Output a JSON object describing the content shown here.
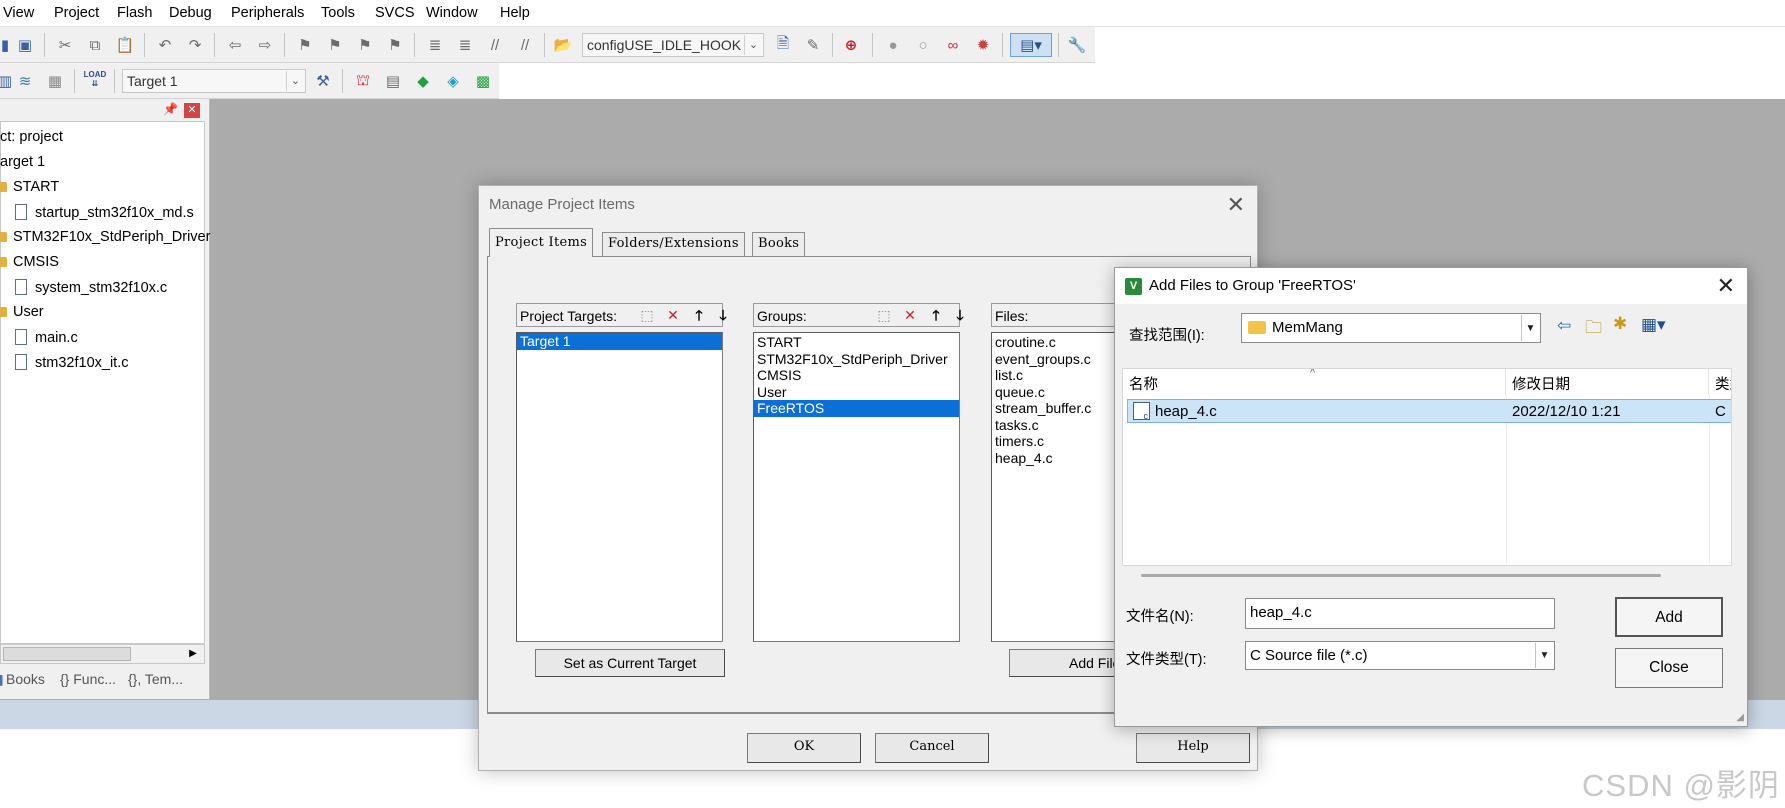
{
  "menu": [
    "View",
    "Project",
    "Flash",
    "Debug",
    "Peripherals",
    "Tools",
    "SVCS",
    "Window",
    "Help"
  ],
  "toolbar": {
    "find_combo": "configUSE_IDLE_HOOK",
    "target_combo": "Target 1"
  },
  "project_panel": {
    "root": "ct: project",
    "target": "arget 1",
    "nodes": [
      {
        "label": "START",
        "kind": "group"
      },
      {
        "label": "startup_stm32f10x_md.s",
        "kind": "file"
      },
      {
        "label": "STM32F10x_StdPeriph_Driver",
        "kind": "group"
      },
      {
        "label": "CMSIS",
        "kind": "group"
      },
      {
        "label": "system_stm32f10x.c",
        "kind": "file"
      },
      {
        "label": "User",
        "kind": "group"
      },
      {
        "label": "main.c",
        "kind": "file"
      },
      {
        "label": "stm32f10x_it.c",
        "kind": "file"
      }
    ],
    "tabs": [
      "Books",
      "{} Func...",
      "{}, Tem..."
    ]
  },
  "manage_dialog": {
    "title": "Manage Project Items",
    "tabs": [
      "Project Items",
      "Folders/Extensions",
      "Books"
    ],
    "targets_label": "Project Targets:",
    "groups_label": "Groups:",
    "files_label": "Files:",
    "targets": [
      "Target 1"
    ],
    "groups": [
      "START",
      "STM32F10x_StdPeriph_Driver",
      "CMSIS",
      "User",
      "FreeRTOS"
    ],
    "selected_group": "FreeRTOS",
    "files": [
      "croutine.c",
      "event_groups.c",
      "list.c",
      "queue.c",
      "stream_buffer.c",
      "tasks.c",
      "timers.c",
      "heap_4.c"
    ],
    "set_target_btn": "Set as Current Target",
    "add_files_btn": "Add Files...",
    "ok_btn": "OK",
    "cancel_btn": "Cancel",
    "help_btn": "Help"
  },
  "add_files_dialog": {
    "title": "Add Files to Group 'FreeRTOS'",
    "look_in_label": "查找范围(I):",
    "look_in_value": "MemMang",
    "col_name": "名称",
    "col_date": "修改日期",
    "col_type": "类型",
    "file_name": "heap_4.c",
    "file_date": "2022/12/10 1:21",
    "file_type": "C Source file",
    "filename_label": "文件名(N):",
    "filename_value": "heap_4.c",
    "filetype_label": "文件类型(T):",
    "filetype_value": "C Source file (*.c)",
    "add_btn": "Add",
    "close_btn": "Close"
  },
  "watermark": "CSDN @影阴",
  "colors": {
    "selection": "#0a70d8",
    "ide_background": "#ababab",
    "file_row_highlight": "#cce4f7"
  }
}
